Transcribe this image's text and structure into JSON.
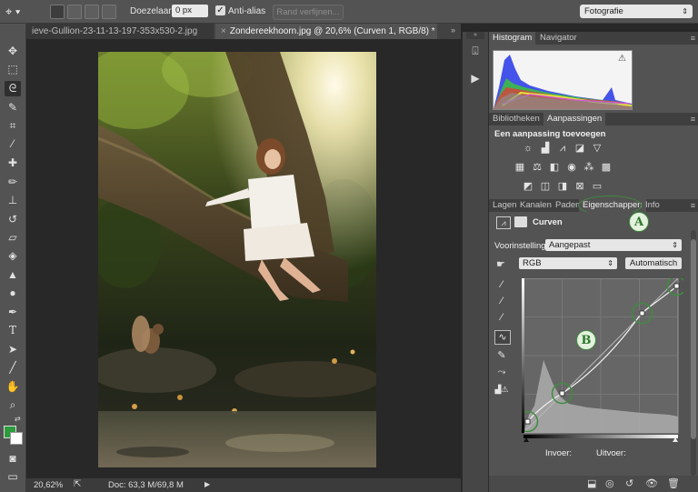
{
  "options_bar": {
    "feather_label": "Doezelaar:",
    "feather_value": "0 px",
    "antialias_label": "Anti-alias",
    "antialias_checked": true,
    "refine_button": "Rand verfijnen...",
    "workspace": "Fotografie"
  },
  "tabs": [
    {
      "label": "ieve-Gullion-23-11-13-197-353x530-2.jpg",
      "active": false
    },
    {
      "label": "Zondereekhoorn.jpg @ 20,6% (Curven 1, RGB/8) *",
      "active": true
    }
  ],
  "status": {
    "zoom": "20,62%",
    "doc": "Doc: 63,3 M/69,8 M"
  },
  "panels": {
    "histogram_tabs": [
      "Histogram",
      "Navigator"
    ],
    "adjust_tabs": [
      "Bibliotheken",
      "Aanpassingen"
    ],
    "add_adjustment_label": "Een aanpassing toevoegen",
    "prop_tabs": [
      "Lagen",
      "Kanalen",
      "Paden",
      "Eigenschappen",
      "Info"
    ],
    "properties_title": "Curven",
    "preset_label": "Voorinstelling:",
    "preset_value": "Aangepast",
    "channel_value": "RGB",
    "auto_button": "Automatisch",
    "input_label": "Invoer:",
    "output_label": "Uitvoer:"
  },
  "annotations": {
    "a": "A",
    "b": "B"
  },
  "colors": {
    "accent_green": "#3f8b3f",
    "panel_bg": "#535353",
    "dark_bg": "#282828"
  }
}
